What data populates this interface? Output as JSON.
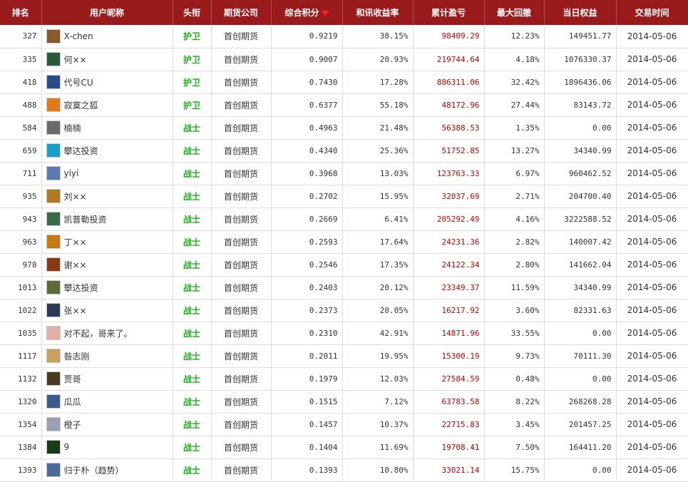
{
  "columns": [
    "排名",
    "用户昵称",
    "头衔",
    "期货公司",
    "综合积分",
    "和讯收益率",
    "累计盈亏",
    "最大回撤",
    "当日权益",
    "交易时间"
  ],
  "sort_indicator": "desc",
  "colors": {
    "header_bg": "#9a1b1b",
    "profit": "#c40000",
    "title": "#1cb01c"
  },
  "rows": [
    {
      "rank": "327",
      "nick": "X-chen",
      "title": "护卫",
      "company": "首创期货",
      "score": "0.9219",
      "yield": "38.15%",
      "profit": "98409.29",
      "drawdown": "12.23%",
      "equity": "149451.77",
      "date": "2014-05-06",
      "avatar": "#8a5a2b"
    },
    {
      "rank": "335",
      "nick": "何××",
      "title": "护卫",
      "company": "首创期货",
      "score": "0.9007",
      "yield": "20.93%",
      "profit": "219744.64",
      "drawdown": "4.18%",
      "equity": "1076330.37",
      "date": "2014-05-06",
      "avatar": "#2c5a3a"
    },
    {
      "rank": "418",
      "nick": "代号CU",
      "title": "护卫",
      "company": "首创期货",
      "score": "0.7430",
      "yield": "17.28%",
      "profit": "886311.06",
      "drawdown": "32.42%",
      "equity": "1896436.06",
      "date": "2014-05-06",
      "avatar": "#2b4c8c"
    },
    {
      "rank": "488",
      "nick": "寂寞之狐",
      "title": "护卫",
      "company": "首创期货",
      "score": "0.6377",
      "yield": "55.18%",
      "profit": "48172.96",
      "drawdown": "27.44%",
      "equity": "83143.72",
      "date": "2014-05-06",
      "avatar": "#e07a1f"
    },
    {
      "rank": "584",
      "nick": "楠楠",
      "title": "战士",
      "company": "首创期货",
      "score": "0.4963",
      "yield": "21.48%",
      "profit": "56388.53",
      "drawdown": "1.35%",
      "equity": "0.00",
      "date": "2014-05-06",
      "avatar": "#6b6b6b"
    },
    {
      "rank": "659",
      "nick": "攀达投资",
      "title": "战士",
      "company": "首创期货",
      "score": "0.4340",
      "yield": "25.36%",
      "profit": "51752.85",
      "drawdown": "13.27%",
      "equity": "34340.99",
      "date": "2014-05-06",
      "avatar": "#1aa0c8"
    },
    {
      "rank": "711",
      "nick": "yiyi",
      "title": "战士",
      "company": "首创期货",
      "score": "0.3968",
      "yield": "13.03%",
      "profit": "123763.33",
      "drawdown": "6.97%",
      "equity": "960462.52",
      "date": "2014-05-06",
      "avatar": "#5a7ab0"
    },
    {
      "rank": "935",
      "nick": "刘××",
      "title": "战士",
      "company": "首创期货",
      "score": "0.2702",
      "yield": "15.95%",
      "profit": "32037.69",
      "drawdown": "2.71%",
      "equity": "204700.40",
      "date": "2014-05-06",
      "avatar": "#b07a20"
    },
    {
      "rank": "943",
      "nick": "凯普勒投资",
      "title": "战士",
      "company": "首创期货",
      "score": "0.2669",
      "yield": "6.41%",
      "profit": "205292.49",
      "drawdown": "4.16%",
      "equity": "3222588.52",
      "date": "2014-05-06",
      "avatar": "#3a6a4a"
    },
    {
      "rank": "963",
      "nick": "丁××",
      "title": "战士",
      "company": "首创期货",
      "score": "0.2593",
      "yield": "17.64%",
      "profit": "24231.36",
      "drawdown": "2.82%",
      "equity": "140007.42",
      "date": "2014-05-06",
      "avatar": "#c87a10"
    },
    {
      "rank": "978",
      "nick": "谢××",
      "title": "战士",
      "company": "首创期货",
      "score": "0.2546",
      "yield": "17.35%",
      "profit": "24122.34",
      "drawdown": "2.80%",
      "equity": "141662.04",
      "date": "2014-05-06",
      "avatar": "#8a3a10"
    },
    {
      "rank": "1013",
      "nick": "攀达投资",
      "title": "战士",
      "company": "首创期货",
      "score": "0.2403",
      "yield": "20.12%",
      "profit": "23349.37",
      "drawdown": "11.59%",
      "equity": "34340.99",
      "date": "2014-05-06",
      "avatar": "#5a6a3a"
    },
    {
      "rank": "1022",
      "nick": "张××",
      "title": "战士",
      "company": "首创期货",
      "score": "0.2373",
      "yield": "20.05%",
      "profit": "16217.92",
      "drawdown": "3.60%",
      "equity": "82331.63",
      "date": "2014-05-06",
      "avatar": "#2a3a5a"
    },
    {
      "rank": "1035",
      "nick": "对不起，哥来了。",
      "title": "战士",
      "company": "首创期货",
      "score": "0.2310",
      "yield": "42.91%",
      "profit": "14871.96",
      "drawdown": "33.55%",
      "equity": "0.00",
      "date": "2014-05-06",
      "avatar": "#e0b0a8"
    },
    {
      "rank": "1117",
      "nick": "昝志刚",
      "title": "战士",
      "company": "首创期货",
      "score": "0.2011",
      "yield": "19.95%",
      "profit": "15300.19",
      "drawdown": "9.73%",
      "equity": "70111.30",
      "date": "2014-05-06",
      "avatar": "#c8a060"
    },
    {
      "rank": "1132",
      "nick": "贾哥",
      "title": "战士",
      "company": "首创期货",
      "score": "0.1979",
      "yield": "12.03%",
      "profit": "27584.59",
      "drawdown": "0.48%",
      "equity": "0.00",
      "date": "2014-05-06",
      "avatar": "#4a3a20"
    },
    {
      "rank": "1320",
      "nick": "瓜瓜",
      "title": "战士",
      "company": "首创期货",
      "score": "0.1515",
      "yield": "7.12%",
      "profit": "63783.58",
      "drawdown": "8.22%",
      "equity": "268268.28",
      "date": "2014-05-06",
      "avatar": "#3a5a8a"
    },
    {
      "rank": "1354",
      "nick": "橙子",
      "title": "战士",
      "company": "首创期货",
      "score": "0.1457",
      "yield": "10.37%",
      "profit": "22715.83",
      "drawdown": "3.45%",
      "equity": "201457.25",
      "date": "2014-05-06",
      "avatar": "#9aa0b0"
    },
    {
      "rank": "1384",
      "nick": "9",
      "title": "战士",
      "company": "首创期货",
      "score": "0.1404",
      "yield": "11.69%",
      "profit": "19708.41",
      "drawdown": "7.50%",
      "equity": "164411.20",
      "date": "2014-05-06",
      "avatar": "#1a3a1a"
    },
    {
      "rank": "1393",
      "nick": "归于朴（趋势）",
      "title": "战士",
      "company": "首创期货",
      "score": "0.1393",
      "yield": "10.80%",
      "profit": "33021.14",
      "drawdown": "15.75%",
      "equity": "0.00",
      "date": "2014-05-06",
      "avatar": "#4a6a9a"
    }
  ]
}
